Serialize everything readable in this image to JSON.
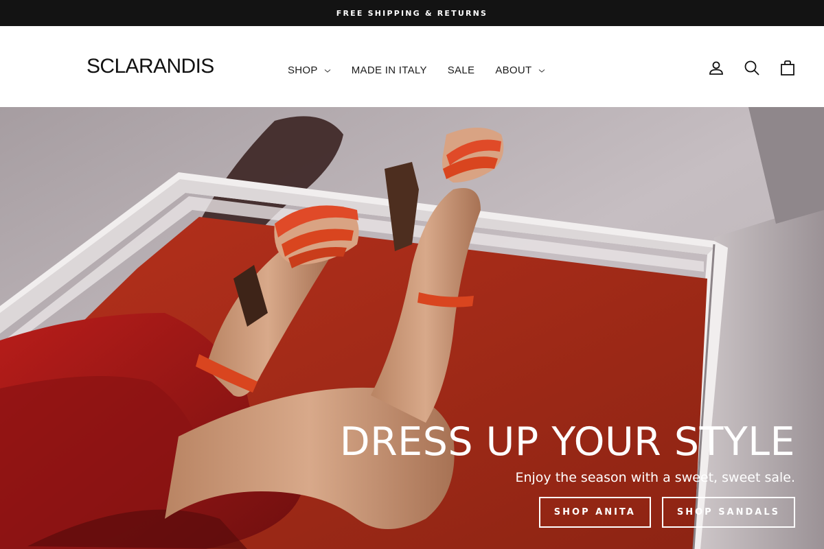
{
  "announcement": {
    "text": "FREE SHIPPING & RETURNS"
  },
  "header": {
    "logo": "SCLARANDIS",
    "nav": [
      {
        "label": "SHOP",
        "has_dropdown": true
      },
      {
        "label": "MADE IN ITALY",
        "has_dropdown": false
      },
      {
        "label": "SALE",
        "has_dropdown": false
      },
      {
        "label": "ABOUT",
        "has_dropdown": true
      }
    ],
    "icons": [
      "account-icon",
      "search-icon",
      "cart-icon"
    ]
  },
  "hero": {
    "title": "DRESS UP YOUR STYLE",
    "subtitle": "Enjoy the season with a sweet, sweet sale.",
    "buttons": [
      {
        "label": "SHOP ANITA"
      },
      {
        "label": "SHOP SANDALS"
      }
    ]
  },
  "colors": {
    "announcement_bg": "#131313",
    "text_dark": "#111111",
    "hero_text": "#ffffff",
    "accent_red": "#c8331f"
  }
}
